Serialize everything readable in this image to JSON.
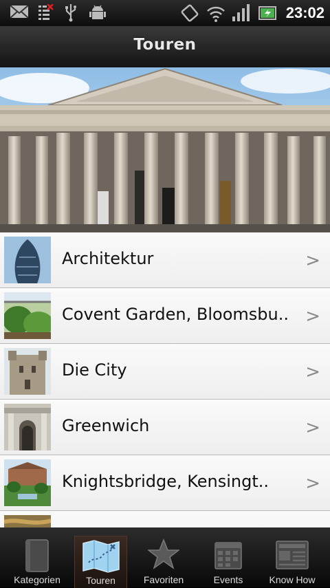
{
  "status_bar": {
    "time": "23:02",
    "icons": [
      "email-icon",
      "missed-call-icon",
      "usb-icon",
      "android-debug-icon",
      "rotation-icon",
      "wifi-icon",
      "signal-icon",
      "battery-charging-icon"
    ]
  },
  "header": {
    "title": "Touren"
  },
  "list": {
    "items": [
      {
        "label": "Architektur",
        "chevron": ">"
      },
      {
        "label": "Covent Garden, Bloomsbu..",
        "chevron": ">"
      },
      {
        "label": "Die City",
        "chevron": ">"
      },
      {
        "label": "Greenwich",
        "chevron": ">"
      },
      {
        "label": "Knightsbridge, Kensingt..",
        "chevron": ">"
      }
    ]
  },
  "tabs": [
    {
      "label": "Kategorien",
      "icon": "book-icon"
    },
    {
      "label": "Touren",
      "icon": "map-icon",
      "active": true
    },
    {
      "label": "Favoriten",
      "icon": "star-icon"
    },
    {
      "label": "Events",
      "icon": "calendar-icon"
    },
    {
      "label": "Know How",
      "icon": "newspaper-icon"
    }
  ],
  "colors": {
    "status_bg": "#111111",
    "header_bg": "#2a2a2a",
    "list_bg": "#f2f2f2",
    "tab_bg": "#1a1a1a",
    "accent_blue": "#9fd3f0"
  }
}
